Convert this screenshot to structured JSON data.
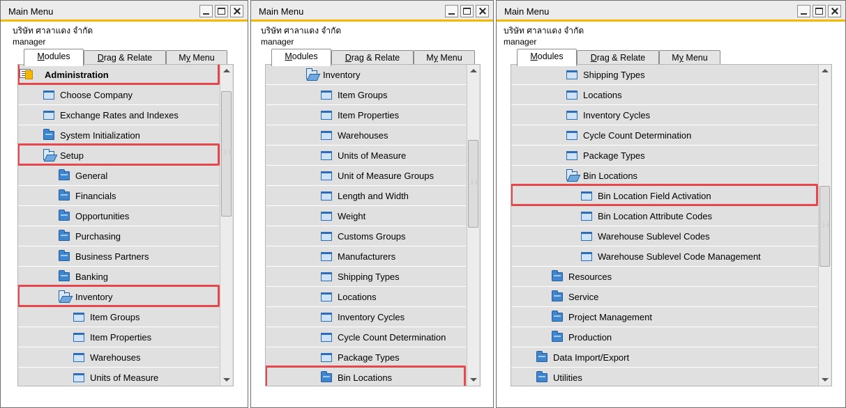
{
  "window": {
    "title": "Main Menu",
    "company": "บริษัท ศาลาแดง จำกัด",
    "user": "manager",
    "tabs": [
      {
        "pre": "",
        "ul": "M",
        "post": "odules"
      },
      {
        "pre": "",
        "ul": "D",
        "post": "rag & Relate"
      },
      {
        "pre": "M",
        "ul": "y",
        "post": " Menu"
      }
    ]
  },
  "panel1": {
    "rows": [
      {
        "label": "Administration",
        "icon": "module-icon",
        "bold": true
      },
      {
        "label": "Choose Company",
        "icon": "window-icon"
      },
      {
        "label": "Exchange Rates and Indexes",
        "icon": "window-icon"
      },
      {
        "label": "System Initialization",
        "icon": "folder-icon"
      },
      {
        "label": "Setup",
        "icon": "folder-open-icon"
      },
      {
        "label": "General",
        "icon": "folder-icon"
      },
      {
        "label": "Financials",
        "icon": "folder-icon"
      },
      {
        "label": "Opportunities",
        "icon": "folder-icon"
      },
      {
        "label": "Purchasing",
        "icon": "folder-icon"
      },
      {
        "label": "Business Partners",
        "icon": "folder-icon"
      },
      {
        "label": "Banking",
        "icon": "folder-icon"
      },
      {
        "label": "Inventory",
        "icon": "folder-open-icon"
      },
      {
        "label": "Item Groups",
        "icon": "window-icon"
      },
      {
        "label": "Item Properties",
        "icon": "window-icon"
      },
      {
        "label": "Warehouses",
        "icon": "window-icon"
      },
      {
        "label": "Units of Measure",
        "icon": "window-icon"
      }
    ]
  },
  "panel2": {
    "rows": [
      {
        "label": "Inventory",
        "icon": "folder-open-icon"
      },
      {
        "label": "Item Groups",
        "icon": "window-icon"
      },
      {
        "label": "Item Properties",
        "icon": "window-icon"
      },
      {
        "label": "Warehouses",
        "icon": "window-icon"
      },
      {
        "label": "Units of Measure",
        "icon": "window-icon"
      },
      {
        "label": "Unit of Measure Groups",
        "icon": "window-icon"
      },
      {
        "label": "Length and Width",
        "icon": "window-icon"
      },
      {
        "label": "Weight",
        "icon": "window-icon"
      },
      {
        "label": "Customs Groups",
        "icon": "window-icon"
      },
      {
        "label": "Manufacturers",
        "icon": "window-icon"
      },
      {
        "label": "Shipping Types",
        "icon": "window-icon"
      },
      {
        "label": "Locations",
        "icon": "window-icon"
      },
      {
        "label": "Inventory Cycles",
        "icon": "window-icon"
      },
      {
        "label": "Cycle Count Determination",
        "icon": "window-icon"
      },
      {
        "label": "Package Types",
        "icon": "window-icon"
      },
      {
        "label": "Bin Locations",
        "icon": "folder-icon"
      }
    ]
  },
  "panel3": {
    "rows": [
      {
        "label": "Shipping Types",
        "icon": "window-icon"
      },
      {
        "label": "Locations",
        "icon": "window-icon"
      },
      {
        "label": "Inventory Cycles",
        "icon": "window-icon"
      },
      {
        "label": "Cycle Count Determination",
        "icon": "window-icon"
      },
      {
        "label": "Package Types",
        "icon": "window-icon"
      },
      {
        "label": "Bin Locations",
        "icon": "folder-open-icon"
      },
      {
        "label": "Bin Location Field Activation",
        "icon": "window-icon"
      },
      {
        "label": "Bin Location Attribute Codes",
        "icon": "window-icon"
      },
      {
        "label": "Warehouse Sublevel Codes",
        "icon": "window-icon"
      },
      {
        "label": "Warehouse Sublevel Code Management",
        "icon": "window-icon"
      },
      {
        "label": "Resources",
        "icon": "folder-icon"
      },
      {
        "label": "Service",
        "icon": "folder-icon"
      },
      {
        "label": "Project Management",
        "icon": "folder-icon"
      },
      {
        "label": "Production",
        "icon": "folder-icon"
      },
      {
        "label": "Data Import/Export",
        "icon": "folder-icon"
      },
      {
        "label": "Utilities",
        "icon": "folder-icon"
      }
    ]
  },
  "colors": {
    "titlebar_accent": "#f5b800",
    "highlight": "#e5474d",
    "row_background": "#e0e0e0"
  }
}
